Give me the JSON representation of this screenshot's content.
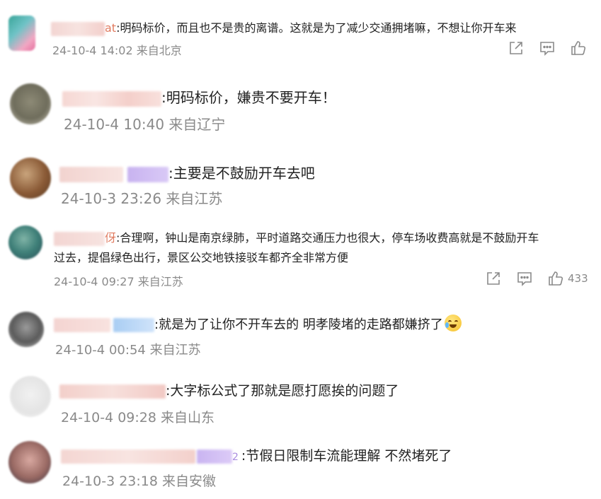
{
  "comments": [
    {
      "name_tail": "at",
      "text": ":明码标价，而且也不是贵的离谱。这就是为了减少交通拥堵嘛，不想让你开车来",
      "time": "24-10-4 14:02",
      "location": "来自北京",
      "likes": ""
    },
    {
      "name_tail": "",
      "text": ":明码标价，嫌贵不要开车！",
      "time": "24-10-4 10:40",
      "location": "来自辽宁"
    },
    {
      "name_tail": "",
      "text": ":主要是不鼓励开车去吧",
      "time": "24-10-3 23:26",
      "location": "来自江苏"
    },
    {
      "name_tail": "伢",
      "text_line1": ":合理啊，钟山是南京绿肺，平时道路交通压力也很大，停车场收费高就是不鼓励开车",
      "text_line2": "过去，提倡绿色出行，景区公交地铁接驳车都齐全非常方便",
      "time": "24-10-4 09:27",
      "location": "来自江苏",
      "likes": "433"
    },
    {
      "name_tail": "",
      "text": ":就是为了让你不开车去的 明孝陵堵的走路都嫌挤了",
      "time": "24-10-4 00:54",
      "location": "来自江苏"
    },
    {
      "name_tail": "",
      "text": ":大字标公式了那就是愿打愿挨的问题了",
      "time": "24-10-4 09:28",
      "location": "来自山东"
    },
    {
      "name_tail": "2",
      "text": ":节假日限制车流能理解 不然堵死了",
      "time": "24-10-3 23:18",
      "location": "来自安徽"
    }
  ],
  "icons": {
    "share": "share-icon",
    "comment": "comment-icon",
    "like": "like-icon",
    "emoji": "laughing-crying-emoji-icon"
  }
}
